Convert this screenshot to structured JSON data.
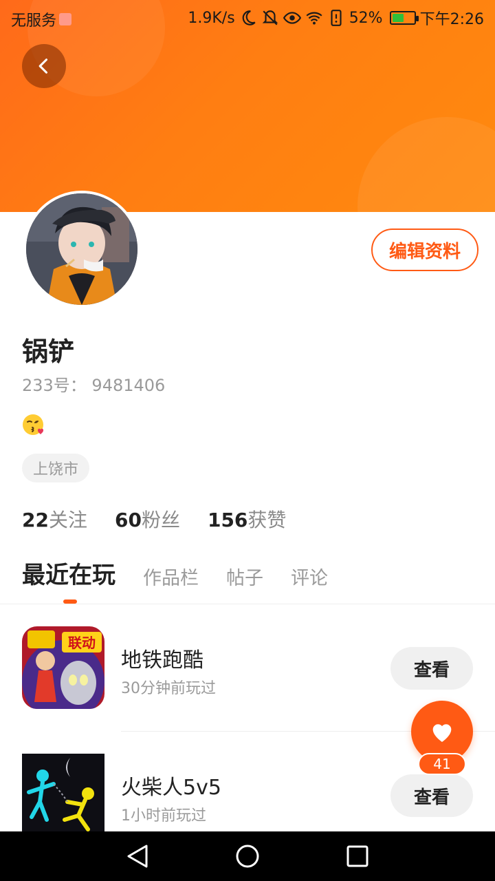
{
  "status_bar": {
    "carrier": "无服务",
    "network_speed": "1.9K/s",
    "battery_percent": "52%",
    "battery_level": 0.52,
    "time": "下午2:26",
    "icons": [
      "moon-icon",
      "mute-icon",
      "eye-icon",
      "wifi-icon",
      "alert-icon",
      "battery-icon"
    ]
  },
  "header": {
    "back_icon": "chevron-left-icon",
    "banner_color": "#ff7a14"
  },
  "profile": {
    "edit_label": "编辑资料",
    "username": "锅铲",
    "id_text": "233号：  9481406",
    "bio_emoji": "😘",
    "location": "上饶市",
    "accent_color": "#ff5a14"
  },
  "stats": [
    {
      "count": "22",
      "label": "关注"
    },
    {
      "count": "60",
      "label": "粉丝"
    },
    {
      "count": "156",
      "label": "获赞"
    }
  ],
  "tabs": [
    {
      "label": "最近在玩",
      "active": true
    },
    {
      "label": "作品栏",
      "active": false
    },
    {
      "label": "帖子",
      "active": false
    },
    {
      "label": "评论",
      "active": false
    }
  ],
  "games": [
    {
      "title": "地铁跑酷",
      "played": "30分钟前玩过",
      "action": "查看",
      "icon_text": "联动"
    },
    {
      "title": "火柴人5v5",
      "played": "1小时前玩过",
      "action": "查看"
    }
  ],
  "like_fab": {
    "icon": "heart-icon",
    "count": "41"
  },
  "nav_bar": {
    "icons": [
      "back-triangle-icon",
      "home-circle-icon",
      "recents-square-icon"
    ]
  }
}
